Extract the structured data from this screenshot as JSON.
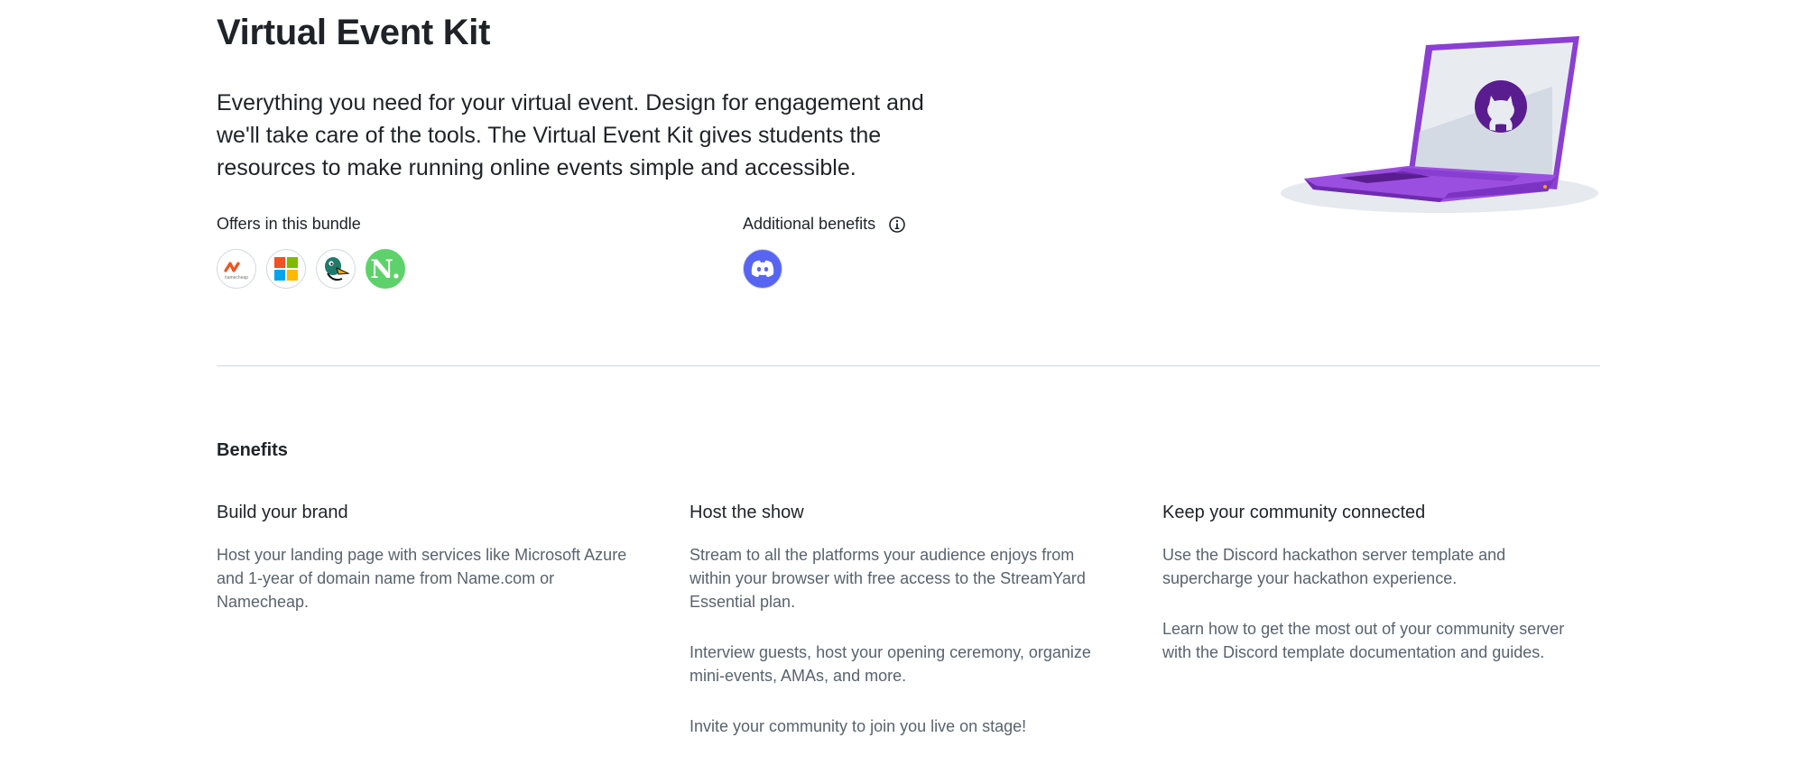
{
  "hero": {
    "title": "Virtual Event Kit",
    "description": "Everything you need for your virtual event. Design for engagement and we'll take care of the tools. The Virtual Event Kit gives students the resources to make running online events simple and accessible."
  },
  "offers": {
    "label": "Offers in this bundle",
    "logos": [
      {
        "name": "namecheap",
        "icon": "namecheap-logo",
        "text": "namecheap"
      },
      {
        "name": "microsoft",
        "icon": "microsoft-logo"
      },
      {
        "name": "streamyard",
        "icon": "duck-logo"
      },
      {
        "name": "notion",
        "icon": "notion-logo",
        "letter": "N."
      }
    ]
  },
  "additional": {
    "label": "Additional benefits",
    "logos": [
      {
        "name": "discord",
        "icon": "discord-logo"
      }
    ]
  },
  "benefits": {
    "title": "Benefits",
    "columns": [
      {
        "heading": "Build your brand",
        "paragraphs": [
          "Host your landing page with services like Microsoft Azure and 1-year of domain name from Name.com or Namecheap."
        ]
      },
      {
        "heading": "Host the show",
        "paragraphs": [
          "Stream to all the platforms your audience enjoys from within your browser with free access to the StreamYard Essential plan.",
          "Interview guests, host your opening ceremony, organize mini-events, AMAs, and more.",
          "Invite your community to join you live on stage!"
        ]
      },
      {
        "heading": "Keep your community connected",
        "paragraphs": [
          "Use the Discord hackathon server template and supercharge your hackathon experience.",
          "Learn how to get the most out of your community server with the Discord template documentation and guides."
        ]
      }
    ]
  },
  "colors": {
    "text": "#1f2328",
    "muted": "#59636e",
    "laptop_purple": "#8a3fd1",
    "discord": "#5865f2",
    "notion_bg": "#5ed26a"
  }
}
